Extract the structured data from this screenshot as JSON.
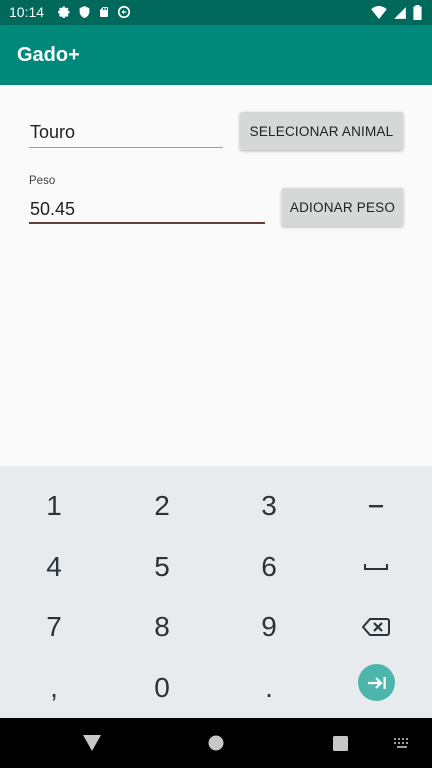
{
  "status_bar": {
    "time": "10:14",
    "left_icons": [
      "settings-icon",
      "shield-icon",
      "sd-card-icon",
      "sync-icon"
    ],
    "right_icons": [
      "wifi-icon",
      "cell-signal-icon",
      "battery-icon"
    ]
  },
  "app_bar": {
    "title": "Gado+"
  },
  "form": {
    "animal_value": "Touro",
    "select_animal_button": "SELECIONAR ANIMAL",
    "weight_label": "Peso",
    "weight_value": "50.45",
    "add_weight_button": "ADIONAR PESO"
  },
  "keyboard": {
    "rows": [
      [
        "1",
        "2",
        "3",
        "-"
      ],
      [
        "4",
        "5",
        "6",
        "space"
      ],
      [
        "7",
        "8",
        "9",
        "backspace"
      ],
      [
        ",",
        "0",
        ".",
        "next"
      ]
    ]
  },
  "nav_bar": {
    "buttons": [
      "back-icon",
      "home-icon",
      "recents-icon",
      "keyboard-switch-icon"
    ]
  },
  "colors": {
    "status_bar": "#00695c",
    "app_bar": "#00897b",
    "accent": "#4db6ac",
    "field_underline_active": "#5d4037",
    "button": "#d6d7d7",
    "keyboard_bg": "#e8ebee"
  }
}
